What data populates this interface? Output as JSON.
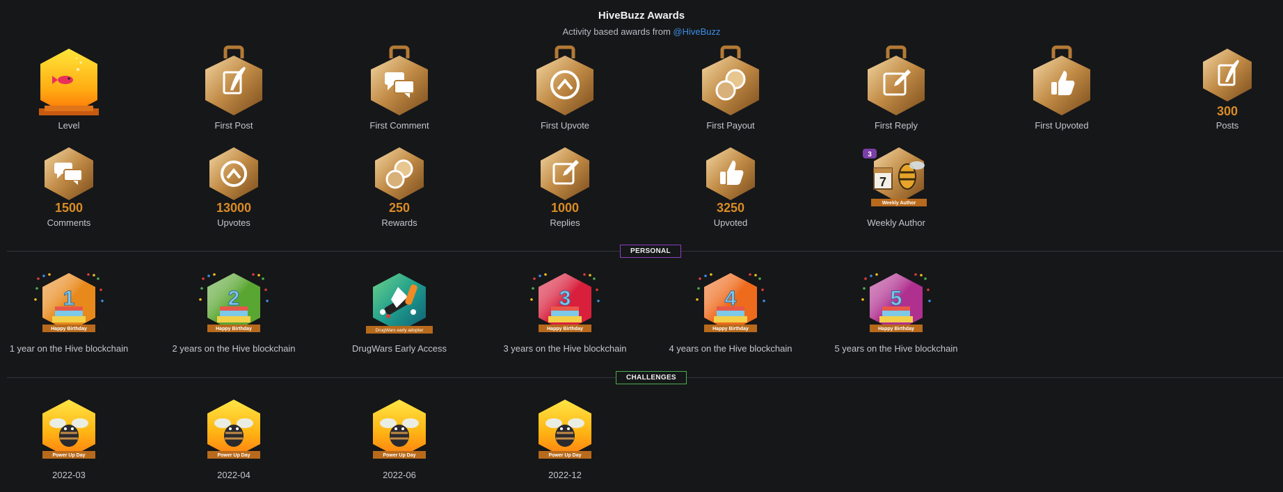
{
  "header": {
    "title": "HiveBuzz Awards",
    "subtitle_prefix": "Activity based awards from ",
    "subtitle_link": "@HiveBuzz"
  },
  "activity_row1": [
    {
      "icon": "fish-level-icon",
      "label": "Level",
      "count": ""
    },
    {
      "icon": "quill-icon",
      "label": "First Post",
      "count": ""
    },
    {
      "icon": "comments-icon",
      "label": "First Comment",
      "count": ""
    },
    {
      "icon": "upvote-icon",
      "label": "First Upvote",
      "count": ""
    },
    {
      "icon": "coins-icon",
      "label": "First Payout",
      "count": ""
    },
    {
      "icon": "edit-icon",
      "label": "First Reply",
      "count": ""
    },
    {
      "icon": "thumbs-up-icon",
      "label": "First Upvoted",
      "count": ""
    },
    {
      "icon": "quill-icon",
      "label": "Posts",
      "count": "300"
    }
  ],
  "activity_row2": [
    {
      "icon": "comments-icon",
      "label": "Comments",
      "count": "1500"
    },
    {
      "icon": "upvote-icon",
      "label": "Upvotes",
      "count": "13000"
    },
    {
      "icon": "coins-icon",
      "label": "Rewards",
      "count": "250"
    },
    {
      "icon": "edit-icon",
      "label": "Replies",
      "count": "1000"
    },
    {
      "icon": "thumbs-up-icon",
      "label": "Upvoted",
      "count": "3250"
    },
    {
      "icon": "weekly-author-icon",
      "label": "Weekly Author",
      "count": "",
      "corner": "3",
      "calendar": "7",
      "ribbon": "Weekly Author"
    }
  ],
  "sections": {
    "personal": "PERSONAL",
    "challenges": "CHALLENGES"
  },
  "personal": [
    {
      "icon": "birthday-cake-icon",
      "label": "1 year on the Hive blockchain",
      "digit": "1",
      "ribbon": "Happy Birthday",
      "color": "#e8891c"
    },
    {
      "icon": "birthday-cake-icon",
      "label": "2 years on the Hive blockchain",
      "digit": "2",
      "ribbon": "Happy Birthday",
      "color": "#5aa632"
    },
    {
      "icon": "drugwars-icon",
      "label": "DrugWars Early Access",
      "digit": "",
      "ribbon": "DrugWars early adopter",
      "color": "#1f9e8d"
    },
    {
      "icon": "birthday-cake-icon",
      "label": "3 years on the Hive blockchain",
      "digit": "3",
      "ribbon": "Happy Birthday",
      "color": "#d81f3c"
    },
    {
      "icon": "birthday-cake-icon",
      "label": "4 years on the Hive blockchain",
      "digit": "4",
      "ribbon": "Happy Birthday",
      "color": "#ee6a1c"
    },
    {
      "icon": "birthday-cake-icon",
      "label": "5 years on the Hive blockchain",
      "digit": "5",
      "ribbon": "Happy Birthday",
      "color": "#b0308f"
    }
  ],
  "challenges": [
    {
      "icon": "bee-icon",
      "label": "2022-03",
      "ribbon": "Power Up Day"
    },
    {
      "icon": "bee-icon",
      "label": "2022-04",
      "ribbon": "Power Up Day"
    },
    {
      "icon": "bee-icon",
      "label": "2022-06",
      "ribbon": "Power Up Day"
    },
    {
      "icon": "bee-icon",
      "label": "2022-12",
      "ribbon": "Power Up Day"
    }
  ],
  "colors": {
    "background": "#161719",
    "bronze_light": "#e8c690",
    "bronze_dark": "#8a5a22",
    "count": "#d98c25",
    "link": "#3b8fe8",
    "personal_border": "#8b3fc4",
    "challenges_border": "#4caf50"
  }
}
